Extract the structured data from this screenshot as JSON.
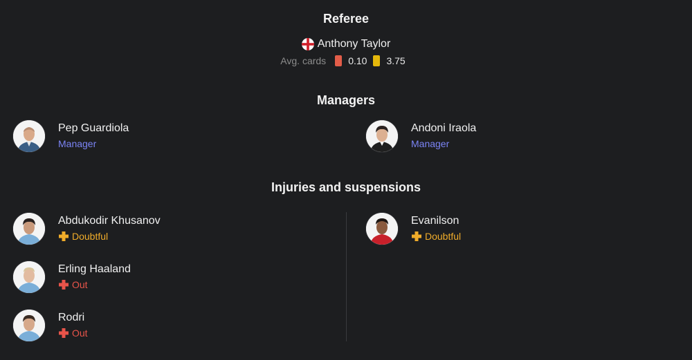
{
  "referee": {
    "title": "Referee",
    "name": "Anthony Taylor",
    "country_flag": "england-flag",
    "avg_cards_label": "Avg. cards",
    "red_cards_avg": "0.10",
    "yellow_cards_avg": "3.75",
    "red_color": "#e35d49",
    "yellow_color": "#e5b80b"
  },
  "managers": {
    "title": "Managers",
    "home": {
      "name": "Pep Guardiola",
      "role": "Manager"
    },
    "away": {
      "name": "Andoni Iraola",
      "role": "Manager"
    }
  },
  "injuries": {
    "title": "Injuries and suspensions",
    "home": [
      {
        "name": "Abdukodir Khusanov",
        "status": "Doubtful",
        "status_type": "doubtful"
      },
      {
        "name": "Erling Haaland",
        "status": "Out",
        "status_type": "out"
      },
      {
        "name": "Rodri",
        "status": "Out",
        "status_type": "out"
      }
    ],
    "away": [
      {
        "name": "Evanilson",
        "status": "Doubtful",
        "status_type": "doubtful"
      }
    ]
  },
  "colors": {
    "background": "#1d1e20",
    "role_accent": "#7b84f5",
    "doubtful": "#f0ac2a",
    "out": "#e8544a"
  }
}
